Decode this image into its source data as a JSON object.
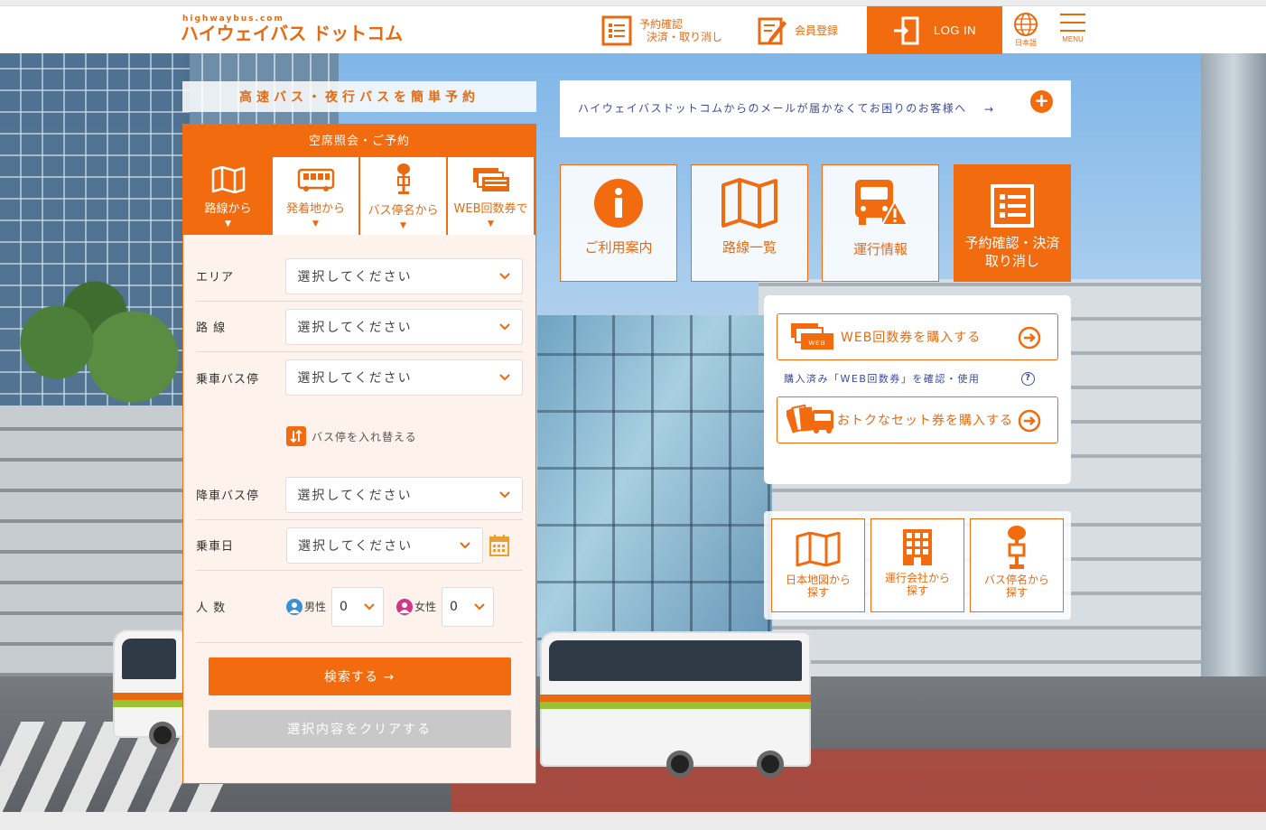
{
  "header": {
    "logo_small": "highwaybus.com",
    "logo_main": "ハイウェイバス ドットコム",
    "reserve_line1": "予約確認",
    "reserve_line2": "決済・取り消し",
    "member": "会員登録",
    "login": "LOG IN",
    "lang": "日本語",
    "menu": "MENU"
  },
  "search": {
    "tagline": "高速バス・夜行バスを簡単予約",
    "title": "空席照会・ご予約",
    "tabs": [
      {
        "label": "路線から",
        "icon": "map-icon",
        "active": true
      },
      {
        "label": "発着地から",
        "icon": "bus-icon",
        "active": false
      },
      {
        "label": "バス停名から",
        "icon": "bus-stop-icon",
        "active": false
      },
      {
        "label": "WEB回数券で",
        "icon": "tickets-icon",
        "active": false
      }
    ],
    "fields": {
      "area_label": "エリア",
      "route_label": "路 線",
      "board_label": "乗車バス停",
      "alight_label": "降車バス停",
      "date_label": "乗車日",
      "pax_label": "人 数",
      "placeholder": "選択してください"
    },
    "swap_label": "バス停を入れ替える",
    "male_label": "男性",
    "female_label": "女性",
    "male_count": "0",
    "female_count": "0",
    "search_button": "検索する →",
    "clear_button": "選択内容をクリアする"
  },
  "notice": {
    "text": "ハイウェイバスドットコムからのメールが届かなくてお困りのお客様へ",
    "arrow": "→",
    "plus": "+"
  },
  "tiles": [
    {
      "label": "ご利用案内",
      "icon": "info-icon"
    },
    {
      "label": "路線一覧",
      "icon": "map-icon"
    },
    {
      "label": "運行情報",
      "icon": "bus-warning-icon"
    },
    {
      "label": "予約確認・決済\n取り消し",
      "icon": "list-icon"
    }
  ],
  "tickets": {
    "buy_web": "WEB回数券を購入する",
    "check_link": "購入済み「WEB回数券」を確認・使用",
    "buy_set": "おトクなセット券を購入する",
    "help": "?"
  },
  "search_by": [
    {
      "line1": "日本地図から",
      "line2": "探す",
      "icon": "japan-map-icon"
    },
    {
      "line1": "運行会社から",
      "line2": "探す",
      "icon": "building-icon"
    },
    {
      "line1": "バス停名から",
      "line2": "探す",
      "icon": "bus-stop-icon"
    }
  ],
  "colors": {
    "accent": "#f26b0f",
    "link": "#3b4aa0",
    "disabled": "#c8c8c8"
  }
}
